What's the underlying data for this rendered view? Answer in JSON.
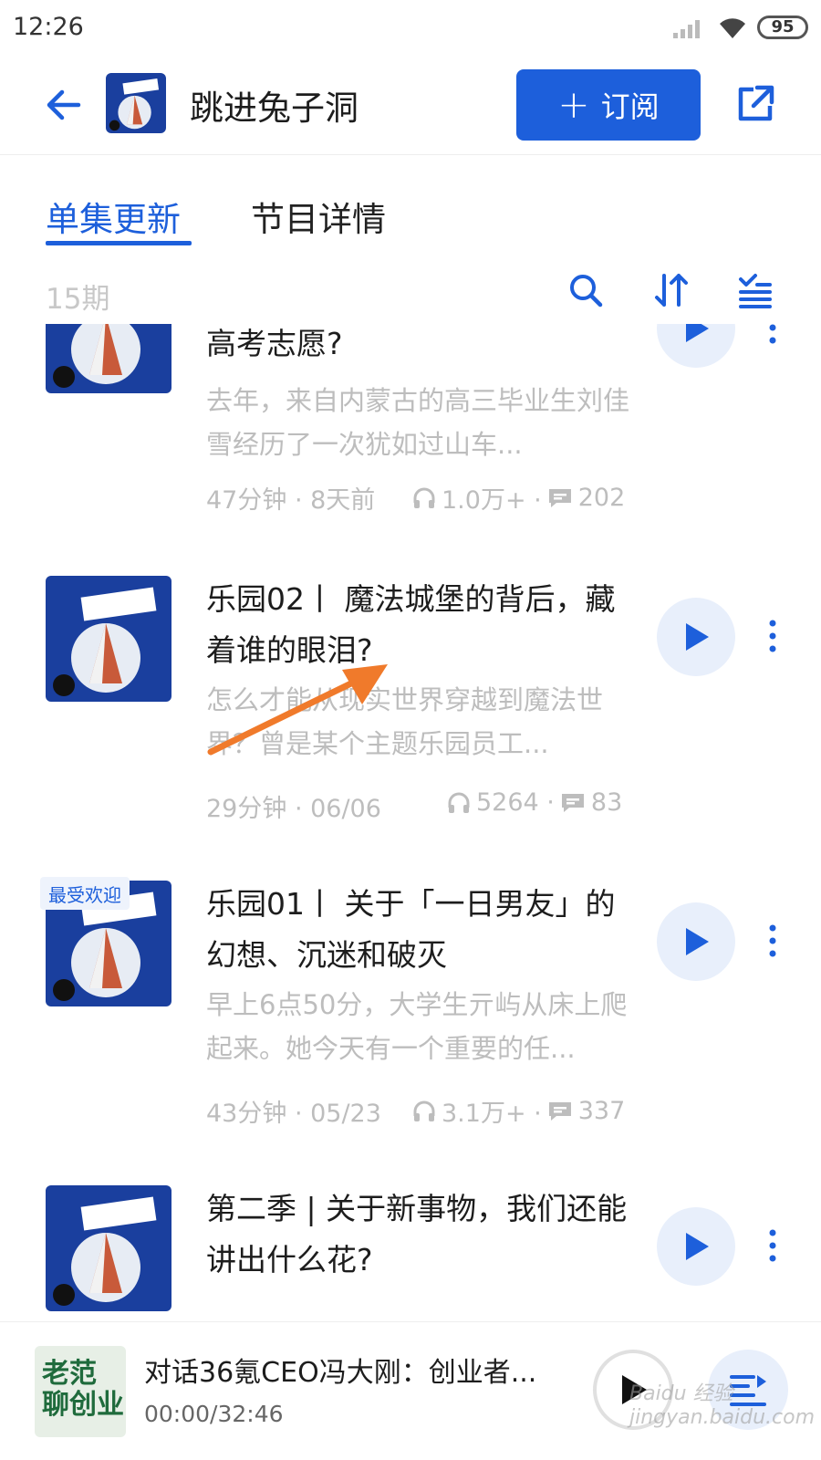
{
  "status": {
    "time": "12:26",
    "battery": "95"
  },
  "header": {
    "title": "跳进兔子洞",
    "subscribe_label": "订阅",
    "subscribe_plus": "+"
  },
  "tabs": [
    {
      "label": "单集更新",
      "active": true
    },
    {
      "label": "节目详情",
      "active": false
    }
  ],
  "list_count": "15期",
  "episodes": [
    {
      "title": "高考志愿?",
      "desc": "去年，来自内蒙古的高三毕业生刘佳雪经历了一次犹如过山车...",
      "meta": "47分钟 · 8天前",
      "plays": "1.0万+ ·",
      "comments": "202"
    },
    {
      "title": "乐园02丨 魔法城堡的背后，藏着谁的眼泪?",
      "desc": "怎么才能从现实世界穿越到魔法世界？曾是某个主题乐园员工...",
      "meta": "29分钟 · 06/06",
      "plays": "5264 ·",
      "comments": "83"
    },
    {
      "title": "乐园01丨 关于「一日男友」的幻想、沉迷和破灭",
      "desc": "早上6点50分，大学生亓屿从床上爬起来。她今天有一个重要的任...",
      "meta": "43分钟 · 05/23",
      "plays": "3.1万+ ·",
      "comments": "337",
      "badge": "最受欢迎"
    },
    {
      "title": "第二季 | 关于新事物，我们还能讲出什么花?",
      "desc": "",
      "meta": "",
      "plays": "",
      "comments": ""
    }
  ],
  "player": {
    "title": "对话36氪CEO冯大刚：创业者...",
    "time": "00:00/32:46",
    "cover_text_1": "老范",
    "cover_text_2": "聊创业"
  },
  "watermark": "Baidu 经验 jingyan.baidu.com",
  "colors": {
    "accent": "#1d5fdb",
    "muted": "#bdbdbd",
    "play_bg": "#e8effb",
    "annotation": "#f07a2b"
  }
}
